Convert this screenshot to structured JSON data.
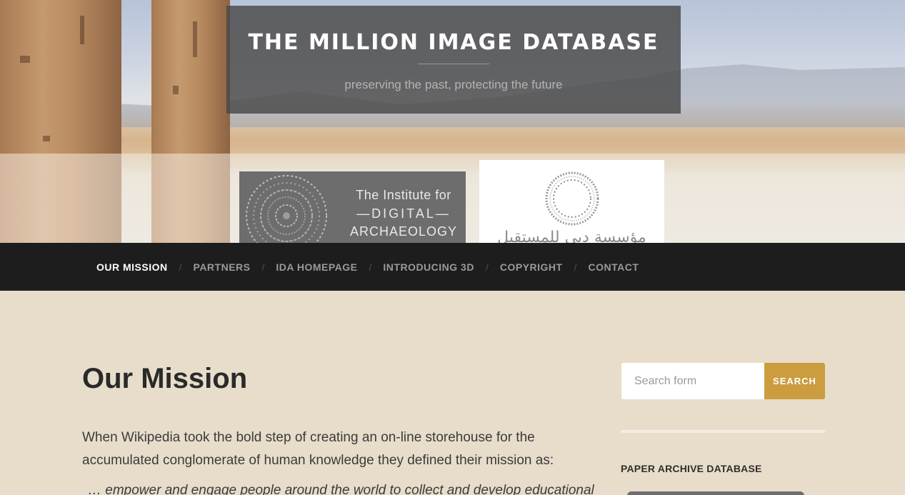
{
  "header": {
    "site_title": "THE MILLION IMAGE DATABASE",
    "tagline": "preserving the past, protecting the future"
  },
  "partners": {
    "ida_logo_lines": [
      "The Institute for",
      "—DIGITAL—",
      "ARCHAEOLOGY"
    ],
    "future_logo_arabic": "مؤسسة دبي للمستقبل"
  },
  "nav": {
    "items": [
      {
        "label": "OUR MISSION",
        "active": true
      },
      {
        "label": "PARTNERS",
        "active": false
      },
      {
        "label": "IDA HOMEPAGE",
        "active": false
      },
      {
        "label": "INTRODUCING 3D",
        "active": false
      },
      {
        "label": "COPYRIGHT",
        "active": false
      },
      {
        "label": "CONTACT",
        "active": false
      }
    ],
    "separator": "/"
  },
  "main": {
    "title": "Our Mission",
    "intro": "When Wikipedia took the bold step of creating an on-line storehouse for the accumulated conglomerate of human knowledge they defined their mission as:",
    "quote_partial": "… empower and engage people around the world to collect and develop educational"
  },
  "sidebar": {
    "search_placeholder": "Search form",
    "search_button": "SEARCH",
    "widget_title": "PAPER ARCHIVE DATABASE"
  },
  "colors": {
    "background": "#e8ddca",
    "nav_background": "#1d1d1d",
    "accent": "#cc9d3f",
    "title_box": "#484848"
  }
}
